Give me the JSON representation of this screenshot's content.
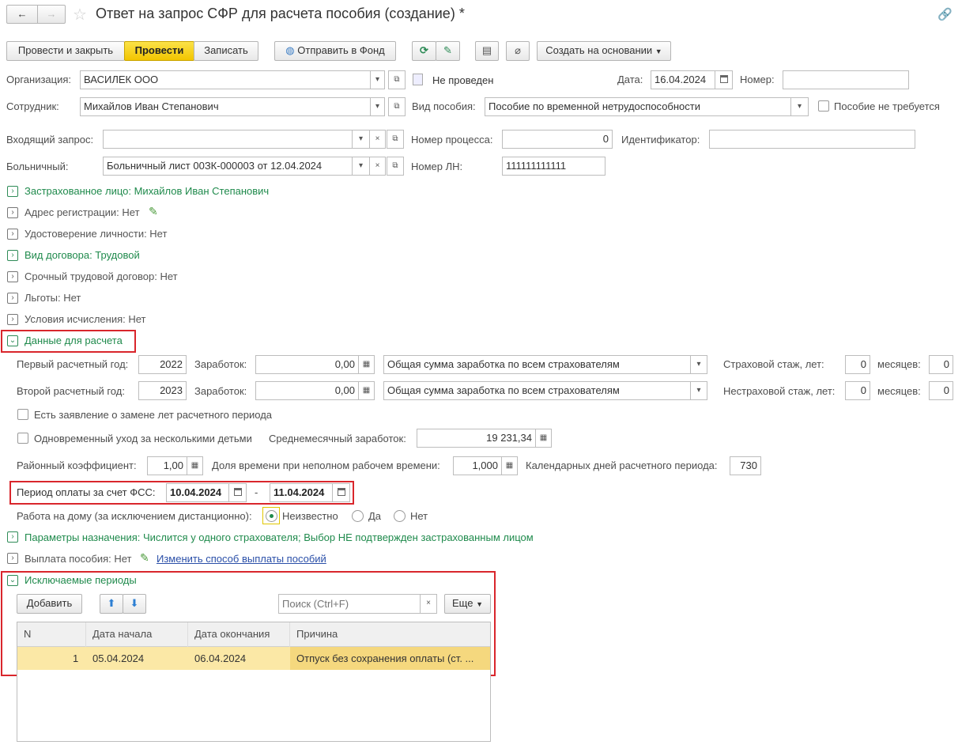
{
  "window": {
    "title": "Ответ на запрос СФР для расчета пособия (создание) *",
    "nav_back": "←",
    "nav_forward": "→"
  },
  "toolbar": {
    "post_close": "Провести и закрыть",
    "post": "Провести",
    "save": "Записать",
    "send_fund": "Отправить в Фонд",
    "create_based": "Создать на основании"
  },
  "header": {
    "org_label": "Организация:",
    "org_value": "ВАСИЛЕК ООО",
    "status": "Не проведен",
    "date_label": "Дата:",
    "date_value": "16.04.2024",
    "number_label": "Номер:",
    "number_value": "",
    "employee_label": "Сотрудник:",
    "employee_value": "Михайлов Иван Степанович",
    "benefit_type_label": "Вид пособия:",
    "benefit_type_value": "Пособие по временной нетрудоспособности",
    "benefit_not_required": "Пособие не требуется",
    "incoming_request_label": "Входящий запрос:",
    "incoming_request_value": "",
    "process_number_label": "Номер процесса:",
    "process_number_value": "0",
    "identifier_label": "Идентификатор:",
    "identifier_value": "",
    "sick_leave_label": "Больничный:",
    "sick_leave_value": "Больничный лист 00ЗК-000003 от 12.04.2024",
    "ln_number_label": "Номер ЛН:",
    "ln_number_value": "111111111111"
  },
  "sections": {
    "insured": "Застрахованное лицо: Михайлов Иван Степанович",
    "address": "Адрес регистрации: Нет",
    "identity": "Удостоверение личности: Нет",
    "contract": "Вид договора: Трудовой",
    "fixed_term": "Срочный трудовой договор: Нет",
    "privileges": "Льготы: Нет",
    "calc_conditions": "Условия исчисления: Нет",
    "calc_data": "Данные для расчета",
    "params": "Параметры назначения: Числится у одного страхователя; Выбор НЕ подтвержден застрахованным лицом",
    "payment": "Выплата пособия: Нет",
    "payment_link": "Изменить способ выплаты пособий",
    "excluded": "Исключаемые периоды"
  },
  "calc": {
    "year1_label": "Первый расчетный год:",
    "year1": "2022",
    "earn_label": "Заработок:",
    "earn1": "0,00",
    "earn_type1": "Общая сумма заработка по всем страхователям",
    "ins_exp_label": "Страховой стаж, лет:",
    "ins_exp_years": "0",
    "months_label": "месяцев:",
    "ins_exp_months": "0",
    "year2_label": "Второй расчетный год:",
    "year2": "2023",
    "earn2": "0,00",
    "earn_type2": "Общая сумма заработка по всем страхователям",
    "nonins_exp_label": "Нестраховой стаж, лет:",
    "nonins_exp_years": "0",
    "nonins_exp_months": "0",
    "replace_years": "Есть заявление о замене лет расчетного периода",
    "multiple_children": "Одновременный уход за несколькими детьми",
    "avg_earn_label": "Среднемесячный заработок:",
    "avg_earn": "19 231,34",
    "district_coef_label": "Районный коэффициент:",
    "district_coef": "1,00",
    "part_time_label": "Доля времени при неполном рабочем времени:",
    "part_time": "1,000",
    "cal_days_label": "Календарных дней расчетного периода:",
    "cal_days": "730",
    "fss_period_label": "Период оплаты за счет ФСС:",
    "fss_from": "10.04.2024",
    "fss_dash": "-",
    "fss_to": "11.04.2024",
    "home_work_label": "Работа на дому (за исключением дистанционно):",
    "home_unknown": "Неизвестно",
    "home_yes": "Да",
    "home_no": "Нет"
  },
  "excluded": {
    "add": "Добавить",
    "search_placeholder": "Поиск (Ctrl+F)",
    "more": "Еще",
    "columns": [
      "N",
      "Дата начала",
      "Дата окончания",
      "Причина"
    ],
    "rows": [
      {
        "n": "1",
        "start": "05.04.2024",
        "end": "06.04.2024",
        "reason": "Отпуск без сохранения оплаты (ст. ..."
      }
    ]
  },
  "colors": {
    "accent_green": "#1f8a4c",
    "primary_yellow": "#f2c500",
    "highlight_red": "#d9262c",
    "selected_row": "#fbe8a6"
  }
}
